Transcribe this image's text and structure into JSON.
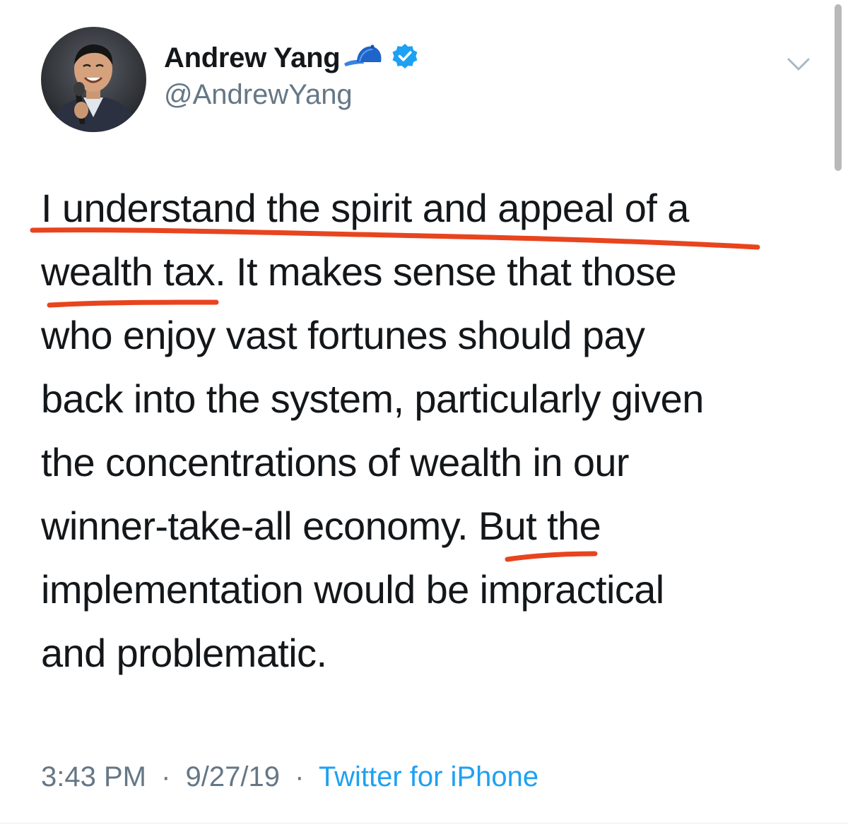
{
  "author": {
    "display_name": "Andrew Yang",
    "handle": "@AndrewYang",
    "verified": true,
    "name_emoji": "cap-icon"
  },
  "tweet": {
    "lines": [
      "I understand the spirit and appeal of a",
      "wealth tax. It makes sense that those",
      "who enjoy vast fortunes should pay",
      "back into the system, particularly given",
      "the concentrations of wealth in our",
      "winner-take-all economy. But the",
      "implementation would be impractical",
      "and problematic."
    ]
  },
  "meta": {
    "time": "3:43 PM",
    "date": "9/27/19",
    "separator": "·",
    "source": "Twitter for iPhone"
  },
  "colors": {
    "text": "#14171a",
    "secondary": "#657786",
    "link": "#1da1f2",
    "annotation": "#e8441e"
  }
}
